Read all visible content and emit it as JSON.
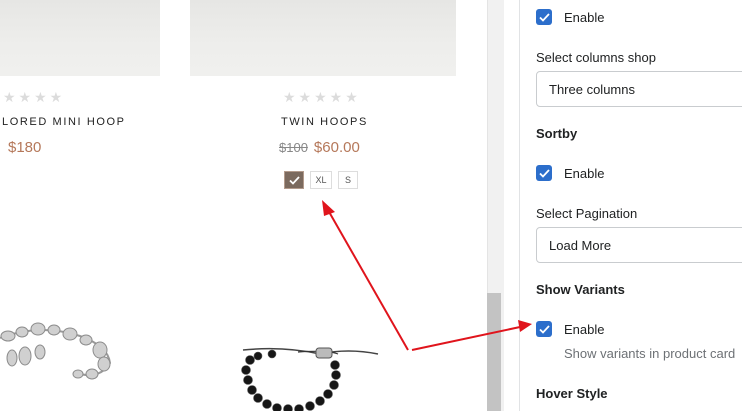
{
  "products": [
    {
      "name": "LORED MINI HOOP",
      "price": "$180",
      "stars": "★★★★"
    },
    {
      "name": "TWIN HOOPS",
      "old_price": "$100",
      "price": "$60.00",
      "stars": "★★★★★",
      "variants": [
        "XL",
        "S"
      ]
    }
  ],
  "settings": {
    "enable_top_label": "Enable",
    "columns_label": "Select columns shop",
    "columns_value": "Three columns",
    "sortby_heading": "Sortby",
    "sortby_enable_label": "Enable",
    "pagination_label": "Select Pagination",
    "pagination_value": "Load More",
    "variants_heading": "Show Variants",
    "variants_enable_label": "Enable",
    "variants_help": "Show variants in product card",
    "hover_heading": "Hover Style"
  },
  "colors": {
    "accent": "#2c6ecb",
    "price": "#b5785a",
    "annotation": "#e0141c"
  }
}
